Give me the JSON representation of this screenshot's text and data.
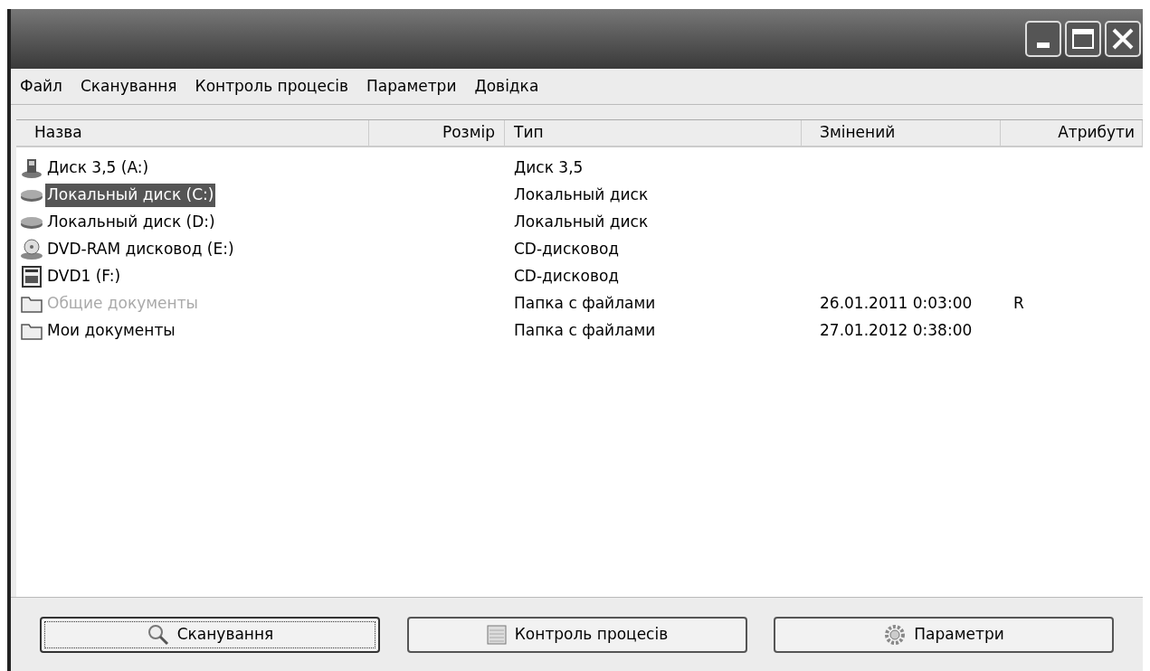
{
  "window": {
    "controls": [
      {
        "kind": "minimize"
      },
      {
        "kind": "maximize"
      },
      {
        "kind": "close"
      }
    ]
  },
  "menu": [
    "Файл",
    "Сканування",
    "Контроль процесів",
    "Параметри",
    "Довідка"
  ],
  "table": {
    "columns": [
      "Назва",
      "Розмір",
      "Тип",
      "Змінений",
      "Атрибути"
    ],
    "rows": [
      {
        "kind": "floppy",
        "name": "Диск 3,5 (A:)",
        "type": "Диск 3,5",
        "selected": false,
        "disabled": false
      },
      {
        "kind": "hdd",
        "name": "Локальный диск (C:)",
        "type": "Локальный диск",
        "selected": true,
        "disabled": false
      },
      {
        "kind": "hdd",
        "name": "Локальный диск (D:)",
        "type": "Локальный диск",
        "selected": false,
        "disabled": false
      },
      {
        "kind": "dvdram",
        "name": "DVD-RAM дисковод (E:)",
        "type": "CD-дисковод",
        "selected": false,
        "disabled": false
      },
      {
        "kind": "cd",
        "name": "DVD1 (F:)",
        "type": "CD-дисковод",
        "selected": false,
        "disabled": false
      },
      {
        "kind": "folder",
        "name": "Общие документы",
        "type": "Папка с файлами",
        "modified": "26.01.2011 0:03:00",
        "attributes": "R",
        "selected": false,
        "disabled": true
      },
      {
        "kind": "folder",
        "name": "Мои документы",
        "type": "Папка с файлами",
        "modified": "27.01.2012 0:38:00",
        "selected": false,
        "disabled": false
      }
    ]
  },
  "buttons": [
    {
      "kind": "scan",
      "label": "Сканування",
      "focused": true
    },
    {
      "kind": "process",
      "label": "Контроль процесів",
      "focused": false
    },
    {
      "kind": "settings",
      "label": "Параметри",
      "focused": false
    }
  ]
}
